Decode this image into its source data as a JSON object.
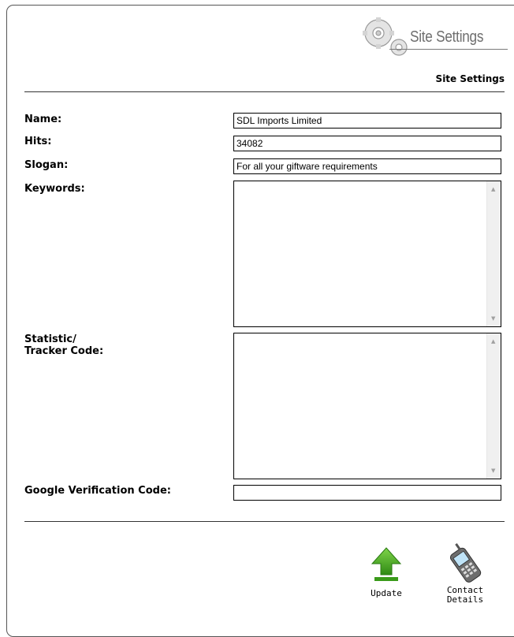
{
  "header": {
    "title": "Site Settings",
    "icon": "gears-icon"
  },
  "section_title": "Site Settings",
  "form": {
    "name": {
      "label": "Name:",
      "value": "SDL Imports Limited"
    },
    "hits": {
      "label": "Hits:",
      "value": "34082"
    },
    "slogan": {
      "label": "Slogan:",
      "value": "For all your giftware requirements"
    },
    "keywords": {
      "label": "Keywords:",
      "value": ""
    },
    "statistic": {
      "label_line1": "Statistic/",
      "label_line2": "Tracker Code:",
      "value": ""
    },
    "google": {
      "label": "Google Verification Code:",
      "value": ""
    }
  },
  "actions": {
    "update": {
      "label": "Update",
      "icon": "upload-arrow-icon",
      "color": "#3a9a1a"
    },
    "contact": {
      "label_line1": "Contact",
      "label_line2": "Details",
      "icon": "mobile-phone-icon"
    }
  }
}
